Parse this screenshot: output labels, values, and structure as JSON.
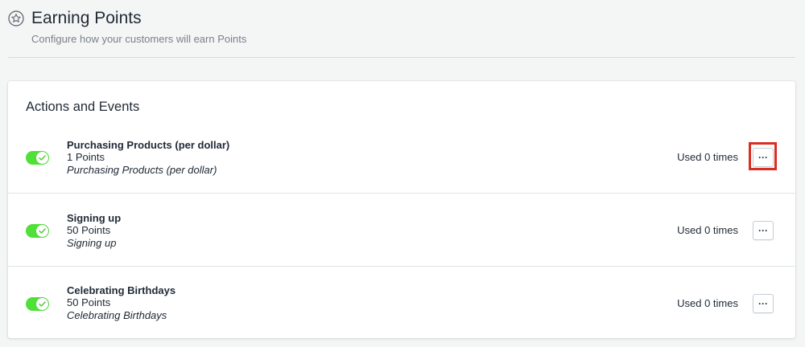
{
  "header": {
    "icon": "star-icon",
    "title": "Earning Points",
    "subtitle": "Configure how your customers will earn Points"
  },
  "card": {
    "title": "Actions and Events",
    "rows": [
      {
        "enabled": true,
        "name": "Purchasing Products (per dollar)",
        "points": "1 Points",
        "description": "Purchasing Products (per dollar)",
        "usage": "Used 0 times",
        "more_label": "···"
      },
      {
        "enabled": true,
        "name": "Signing up",
        "points": "50 Points",
        "description": "Signing up",
        "usage": "Used 0 times",
        "more_label": "···"
      },
      {
        "enabled": true,
        "name": "Celebrating Birthdays",
        "points": "50 Points",
        "description": "Celebrating Birthdays",
        "usage": "Used 0 times",
        "more_label": "···"
      }
    ]
  },
  "colors": {
    "toggle_on": "#50e038",
    "highlight": "#d92e22",
    "background": "#f4f6f6"
  }
}
